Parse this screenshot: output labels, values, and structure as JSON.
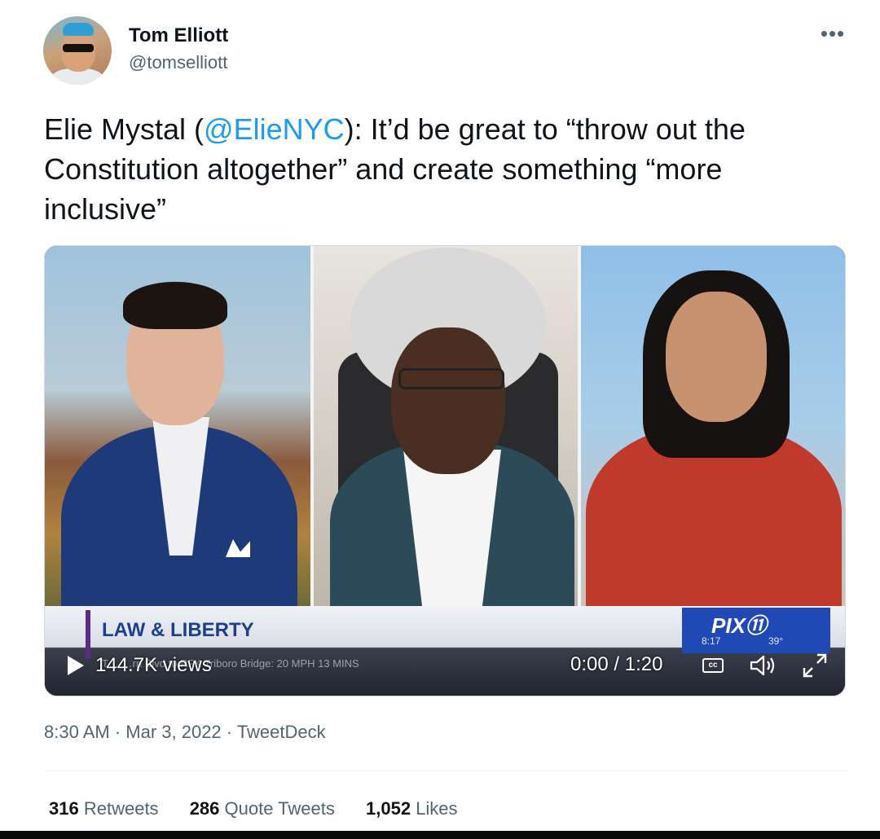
{
  "tweet": {
    "display_name": "Tom Elliott",
    "handle": "@tomselliott",
    "more_icon": "more-horizontal-icon",
    "text_before": "Elie Mystal (",
    "mention": "@ElieNYC",
    "text_after": "): It’d be great to “throw out the Constitution altogether” and create something “more inclusive”",
    "timestamp": "8:30 AM · Mar 3, 2022 · TweetDeck"
  },
  "video": {
    "lower_third_title": "LAW & LIBERTY",
    "channel_logo": "PIX⑪",
    "channel_time": "8:17",
    "channel_temp": "39°",
    "ticker": "T… …rn Blvd to RFK Triboro Bridge: 20 MPH 13 MINS",
    "views": "144.7K views",
    "time": "0:00 / 1:20",
    "cc_label": "cc"
  },
  "stats": [
    {
      "count": "316",
      "label": "Retweets"
    },
    {
      "count": "286",
      "label": "Quote Tweets"
    },
    {
      "count": "1,052",
      "label": "Likes"
    }
  ],
  "colors": {
    "link": "#1d9bf0",
    "text": "#0f1419",
    "secondary": "#536471",
    "pix_blue": "#1f49b6",
    "lower_third_title": "#1d3f8f"
  }
}
